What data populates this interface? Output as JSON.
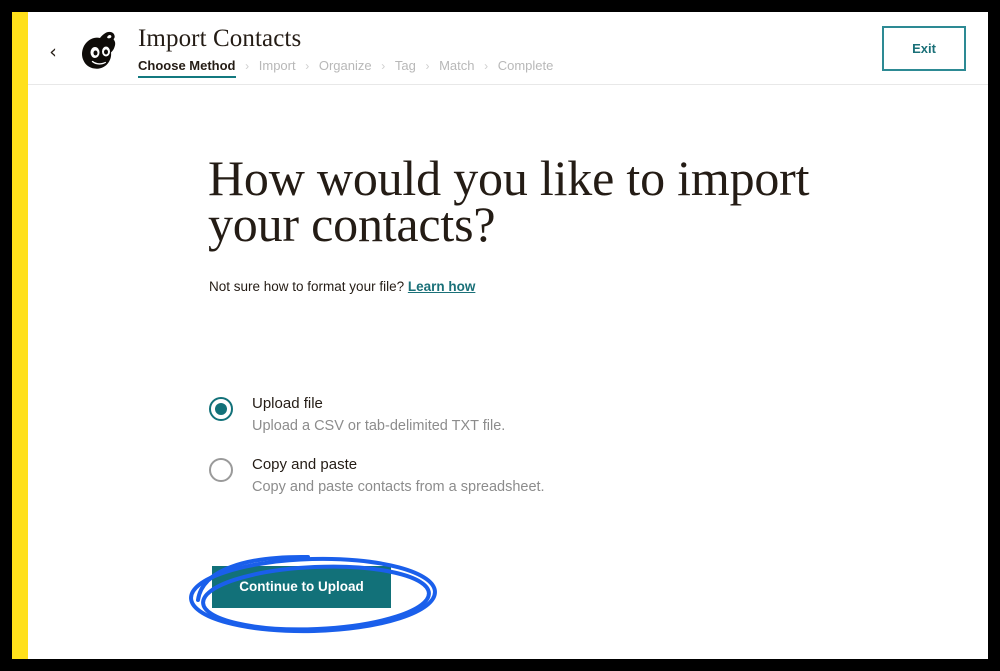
{
  "window": {
    "frame_color": "#000000",
    "brand_stripe_color": "#ffe01b",
    "accent_teal": "#127179",
    "annotation_blue": "#1a5feb"
  },
  "header": {
    "back_icon": "‹",
    "logo_name": "mailchimp-freddie-logo",
    "title": "Import Contacts",
    "breadcrumb": [
      {
        "label": "Choose Method",
        "current": true
      },
      {
        "label": "Import",
        "current": false
      },
      {
        "label": "Organize",
        "current": false
      },
      {
        "label": "Tag",
        "current": false
      },
      {
        "label": "Match",
        "current": false
      },
      {
        "label": "Complete",
        "current": false
      }
    ],
    "separator": "›",
    "exit_label": "Exit"
  },
  "main": {
    "headline": "How would you like to import your contacts?",
    "subline_text": "Not sure how to format your file?",
    "subline_link": "Learn how",
    "options": [
      {
        "label": "Upload file",
        "description": "Upload a CSV or tab-delimited TXT file.",
        "selected": true
      },
      {
        "label": "Copy and paste",
        "description": "Copy and paste contacts from a spreadsheet.",
        "selected": false
      }
    ],
    "cta_label": "Continue to Upload"
  }
}
